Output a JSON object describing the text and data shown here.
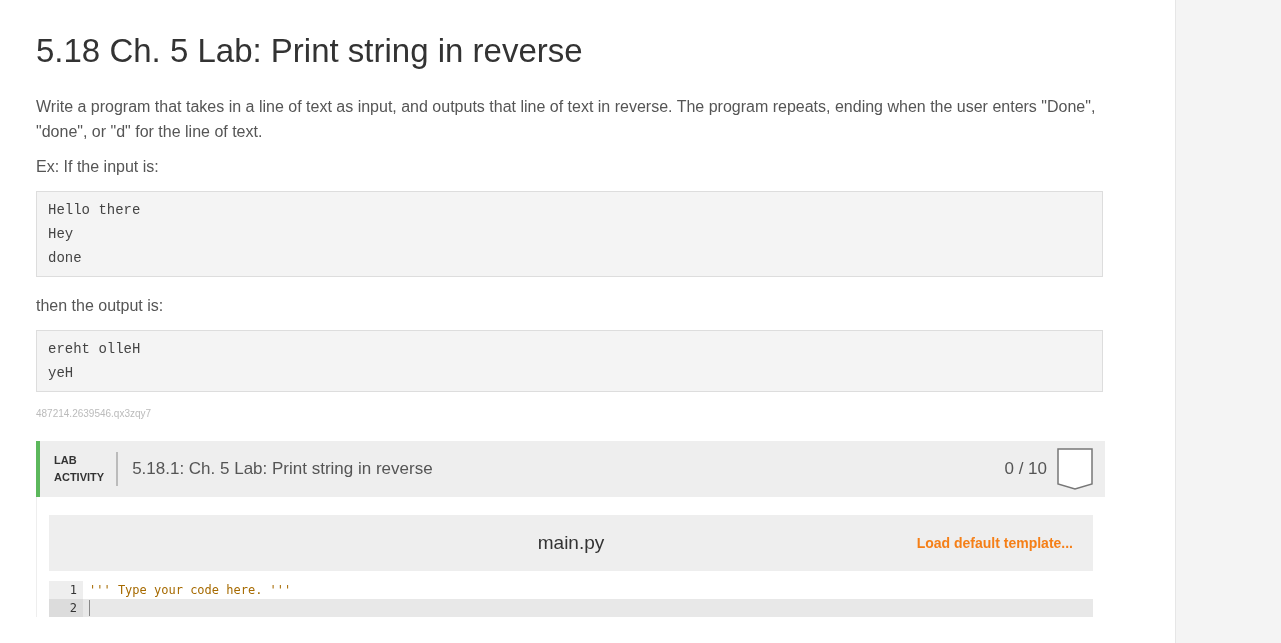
{
  "title": "5.18 Ch. 5 Lab: Print string in reverse",
  "description": "Write a program that takes in a line of text as input, and outputs that line of text in reverse. The program repeats, ending when the user enters \"Done\", \"done\", or \"d\" for the line of text.",
  "input_intro": "Ex: If the input is:",
  "input_example": [
    "Hello there",
    "Hey",
    "done"
  ],
  "output_intro": "then the output is:",
  "output_example": [
    "ereht olleH",
    "yeH"
  ],
  "content_id": "487214.2639546.qx3zqy7",
  "lab": {
    "tag_lines": [
      "LAB",
      "ACTIVITY"
    ],
    "title": "5.18.1: Ch. 5 Lab: Print string in reverse",
    "score": "0 / 10",
    "editor": {
      "filename": "main.py",
      "template_link": "Load default template...",
      "lines": [
        {
          "number": "1",
          "code": "''' Type your code here. '''",
          "active": false
        },
        {
          "number": "2",
          "active": true
        }
      ]
    }
  }
}
